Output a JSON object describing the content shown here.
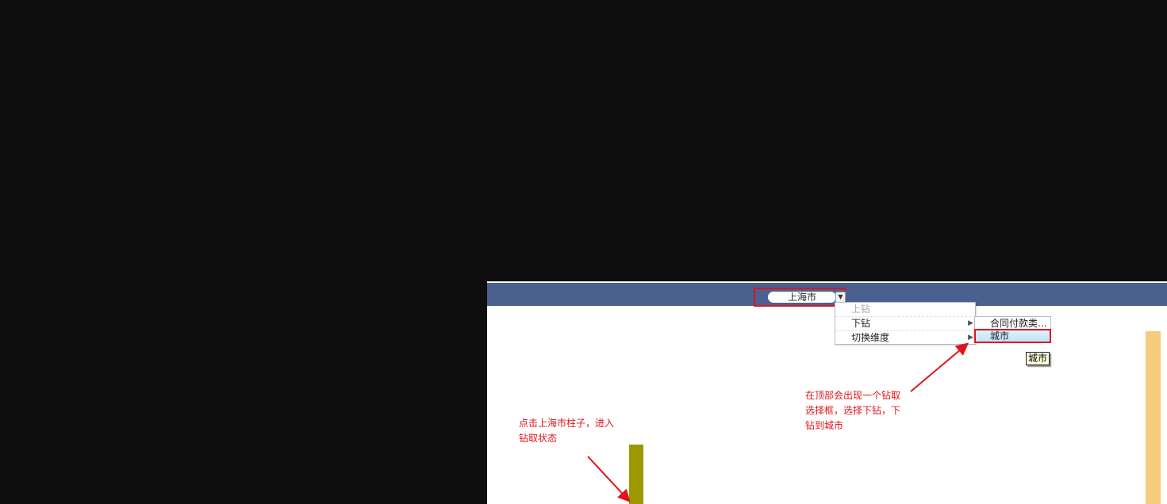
{
  "selector": {
    "breadcrumb": "上海市",
    "dropdown_icon": "chevron-down-icon"
  },
  "context_menu": {
    "items": [
      {
        "label": "上钻",
        "enabled": false
      },
      {
        "label": "下钻",
        "enabled": true,
        "has_submenu": true
      },
      {
        "label": "切换维度",
        "enabled": true,
        "has_submenu": true
      }
    ]
  },
  "submenu": {
    "items": [
      {
        "label": "合同付款类..."
      },
      {
        "label": "城市",
        "highlighted": true
      }
    ]
  },
  "tooltip": "城市",
  "annotations": {
    "left_note": "点击上海市柱子，进入钻取状态",
    "right_note": "在顶部会出现一个钻取选择框，选择下钻，下钻到城市"
  },
  "colors": {
    "topbar": "#4a6190",
    "bar_selected": "#9c9900",
    "bar_other": "#f6cb7c",
    "annotation": "#e0141b",
    "background": "#0e0e0e"
  }
}
